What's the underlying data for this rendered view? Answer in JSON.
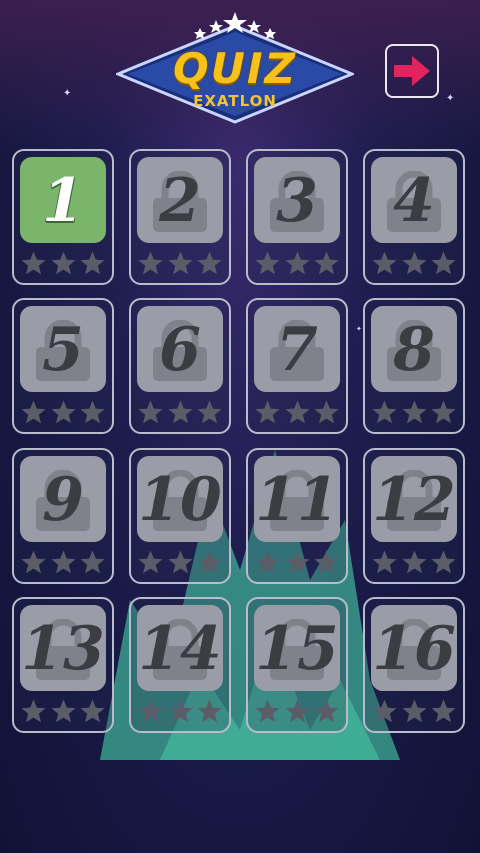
{
  "logo": {
    "title": "QUIZ",
    "subtitle": "EXATLON"
  },
  "next_button": {
    "icon": "arrow-right-icon",
    "color": "#e0245e"
  },
  "levels": [
    {
      "number": "1",
      "locked": false,
      "stars": 0
    },
    {
      "number": "2",
      "locked": true,
      "stars": 0
    },
    {
      "number": "3",
      "locked": true,
      "stars": 0
    },
    {
      "number": "4",
      "locked": true,
      "stars": 0
    },
    {
      "number": "5",
      "locked": true,
      "stars": 0
    },
    {
      "number": "6",
      "locked": true,
      "stars": 0
    },
    {
      "number": "7",
      "locked": true,
      "stars": 0
    },
    {
      "number": "8",
      "locked": true,
      "stars": 0
    },
    {
      "number": "9",
      "locked": true,
      "stars": 0
    },
    {
      "number": "10",
      "locked": true,
      "stars": 0
    },
    {
      "number": "11",
      "locked": true,
      "stars": 0
    },
    {
      "number": "12",
      "locked": true,
      "stars": 0
    },
    {
      "number": "13",
      "locked": true,
      "stars": 0
    },
    {
      "number": "14",
      "locked": true,
      "stars": 0
    },
    {
      "number": "15",
      "locked": true,
      "stars": 0
    },
    {
      "number": "16",
      "locked": true,
      "stars": 0
    }
  ],
  "colors": {
    "unlocked_tile": "#7bb46b",
    "locked_tile": "#9a9da7",
    "star_empty": "#5a5d68",
    "star_filled": "#f6c21a"
  }
}
